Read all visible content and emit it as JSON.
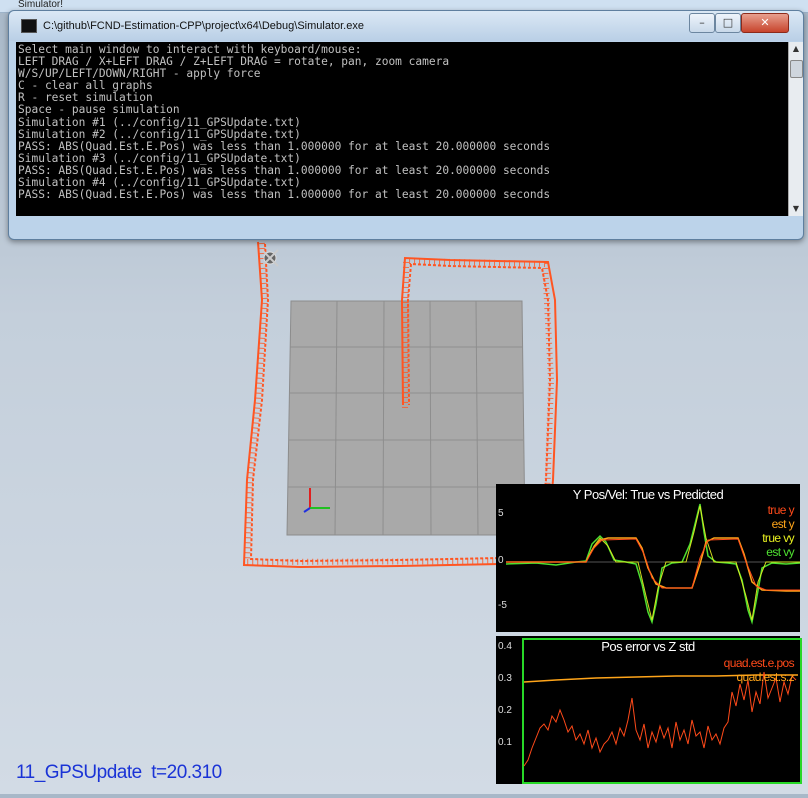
{
  "background_window": {
    "title": "Simulator!"
  },
  "console": {
    "title": "C:\\github\\FCND-Estimation-CPP\\project\\x64\\Debug\\Simulator.exe",
    "buttons": {
      "minimize": "–",
      "maximize": "□",
      "close": "✕"
    },
    "lines": [
      "Select main window to interact with keyboard/mouse:",
      "LEFT DRAG / X+LEFT DRAG / Z+LEFT DRAG = rotate, pan, zoom camera",
      "W/S/UP/LEFT/DOWN/RIGHT - apply force",
      "C - clear all graphs",
      "R - reset simulation",
      "Space - pause simulation",
      "Simulation #1 (../config/11_GPSUpdate.txt)",
      "Simulation #2 (../config/11_GPSUpdate.txt)",
      "PASS: ABS(Quad.Est.E.Pos) was less than 1.000000 for at least 20.000000 seconds",
      "Simulation #3 (../config/11_GPSUpdate.txt)",
      "PASS: ABS(Quad.Est.E.Pos) was less than 1.000000 for at least 20.000000 seconds",
      "Simulation #4 (../config/11_GPSUpdate.txt)",
      "PASS: ABS(Quad.Est.E.Pos) was less than 1.000000 for at least 20.000000 seconds"
    ]
  },
  "graph1": {
    "title": "Y Pos/Vel: True vs Predicted",
    "ticks": [
      "5",
      "0",
      "-5"
    ],
    "legend": [
      {
        "label": "true y",
        "color": "#ff4a1a"
      },
      {
        "label": "est y",
        "color": "#ffa51a"
      },
      {
        "label": "true vy",
        "color": "#e8f020"
      },
      {
        "label": "est vy",
        "color": "#4ee030"
      }
    ]
  },
  "graph2": {
    "title": "Pos error vs Z std",
    "ticks": [
      "0.4",
      "0.3",
      "0.2",
      "0.1"
    ],
    "legend": [
      {
        "label": "quad.est.e.pos",
        "color": "#ff4a1a"
      },
      {
        "label": "quad.est.s.z",
        "color": "#ffa51a"
      }
    ]
  },
  "status": {
    "scenario": "11_GPSUpdate",
    "time": "t=20.310"
  },
  "colors": {
    "trajectory": "#ff5522",
    "floor": "#aaaaaa",
    "graph_frame": "#27d827",
    "status_text": "#1a33d6"
  }
}
